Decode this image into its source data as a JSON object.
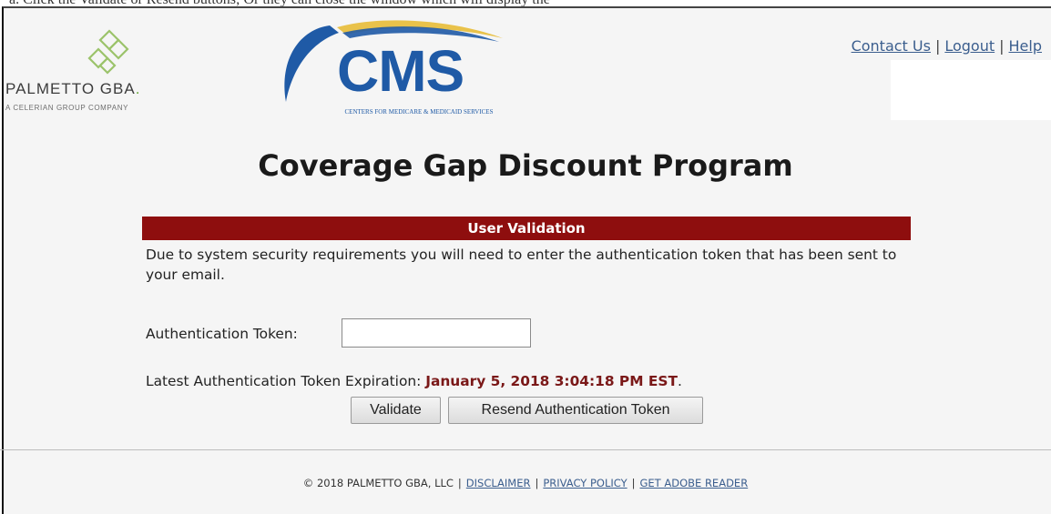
{
  "page": {
    "title": "Coverage Gap Discount Program"
  },
  "clipped_text": "a. Click the Validate or Resend buttons; Or they can close the window which will display the",
  "branding": {
    "palmetto_name": "PALMETTO GBA",
    "palmetto_dot": ".",
    "palmetto_sub": "A CELERIAN GROUP COMPANY",
    "cms_name": "CMS",
    "cms_sub": "CENTERS FOR MEDICARE & MEDICAID SERVICES",
    "palmetto_color": "#6aaa3a",
    "cms_color": "#1f5aa6"
  },
  "header_links": {
    "contact": "Contact Us",
    "logout": "Logout",
    "help": "Help",
    "separator": "|"
  },
  "section": {
    "title": "User Validation",
    "bar_color": "#8e0e0e"
  },
  "instructions": "Due to system security requirements you will need to enter the authentication token that has been sent to your email.",
  "token_field": {
    "label": "Authentication Token:",
    "value": ""
  },
  "expiration": {
    "label": "Latest Authentication Token Expiration:",
    "date": "January 5, 2018 3:04:18 PM EST",
    "suffix": "."
  },
  "buttons": {
    "validate": "Validate",
    "resend": "Resend Authentication Token"
  },
  "footer": {
    "copyright": "© 2018 PALMETTO GBA, LLC",
    "separator": "|",
    "disclaimer": "DISCLAIMER",
    "privacy": "PRIVACY POLICY",
    "adobe": "GET ADOBE READER"
  },
  "icons": {
    "palmetto_logo": "palmetto-diamond-logo-icon",
    "cms_logo": "cms-swoosh-logo-icon"
  }
}
